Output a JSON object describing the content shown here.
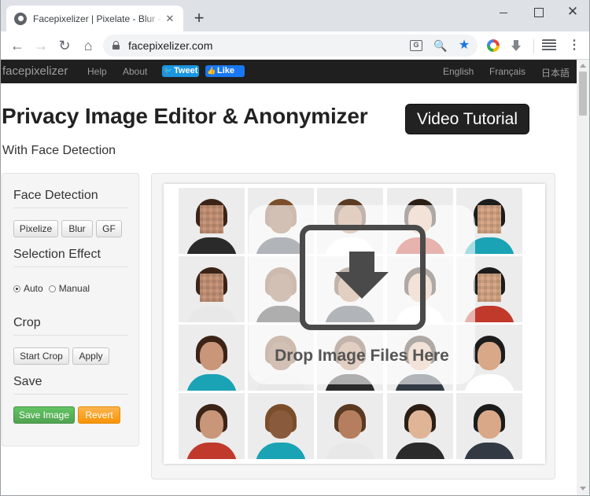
{
  "browser": {
    "tab_title": "Facepixelizer | Pixelate - Blur - Anonymize",
    "tab_close": "✕",
    "new_tab": "+",
    "close": "✕",
    "url": "facepixelizer.com",
    "translate": "G",
    "zoom": "🔍",
    "bookmark": "★",
    "menu": "⋮",
    "back": "←",
    "forward": "→",
    "reload": "↻",
    "home": "⌂"
  },
  "site_nav": {
    "brand": "facepixelizer",
    "links": [
      "Help",
      "About"
    ],
    "tweet_label": "Tweet",
    "like_label": "Like",
    "languages": [
      "English",
      "Français",
      "日本語"
    ]
  },
  "header": {
    "title": "Privacy Image Editor & Anonymizer",
    "video_button": "Video Tutorial",
    "subtitle": "With Face Detection"
  },
  "sidebar": {
    "face_detection": {
      "title": "Face Detection",
      "buttons": [
        "Pixelize",
        "Blur",
        "GF"
      ]
    },
    "selection_effect": {
      "title": "Selection Effect",
      "options": [
        "Auto",
        "Manual"
      ],
      "selected": "Auto"
    },
    "crop": {
      "title": "Crop",
      "buttons": [
        "Start Crop",
        "Apply"
      ]
    },
    "save": {
      "title": "Save",
      "save_button": "Save Image",
      "revert_button": "Revert"
    }
  },
  "editor": {
    "drop_text": "Drop Image Files Here",
    "grid_rows": 4,
    "grid_cols": 5
  }
}
